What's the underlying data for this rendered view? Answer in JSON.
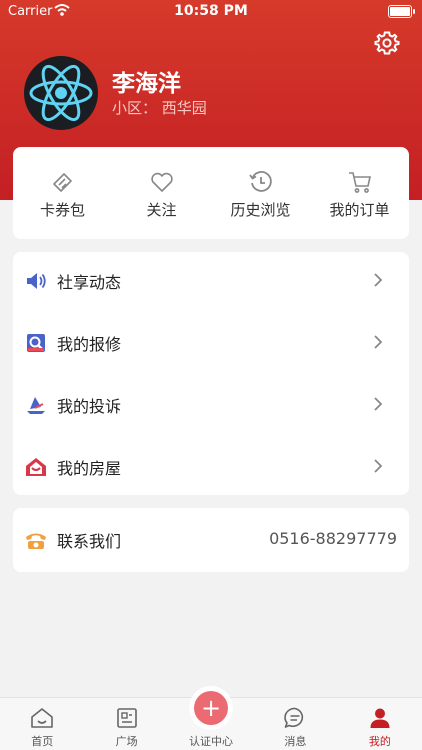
{
  "status_bar": {
    "carrier": "Carrier",
    "time": "10:58 PM"
  },
  "profile": {
    "name": "李海洋",
    "community": "小区：  西华园"
  },
  "quick_actions": [
    {
      "label": "卡券包",
      "icon": "coupon-icon"
    },
    {
      "label": "关注",
      "icon": "heart-icon"
    },
    {
      "label": "历史浏览",
      "icon": "history-icon"
    },
    {
      "label": "我的订单",
      "icon": "cart-icon"
    }
  ],
  "menu": [
    {
      "label": "社享动态",
      "icon": "speaker-icon"
    },
    {
      "label": "我的报修",
      "icon": "repair-icon"
    },
    {
      "label": "我的投诉",
      "icon": "complaint-icon"
    },
    {
      "label": "我的房屋",
      "icon": "house-icon"
    }
  ],
  "contact": {
    "label": "联系我们",
    "phone": "0516-88297779",
    "icon": "telephone-icon"
  },
  "tabbar": [
    {
      "label": "首页",
      "icon": "home-icon"
    },
    {
      "label": "广场",
      "icon": "square-icon"
    },
    {
      "label": "认证中心",
      "icon": "plus-icon"
    },
    {
      "label": "消息",
      "icon": "message-icon"
    },
    {
      "label": "我的",
      "icon": "user-icon",
      "active": true
    }
  ],
  "colors": {
    "brand_red": "#c41f24",
    "accent_pink": "#ec6b73"
  }
}
